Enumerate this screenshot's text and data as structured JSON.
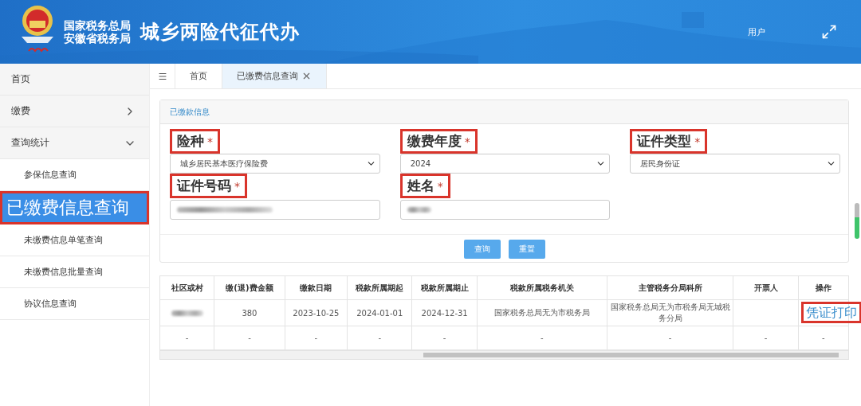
{
  "header": {
    "org_lines": [
      "国家税务总局",
      "安徽省税务局"
    ],
    "title": "城乡两险代征代办",
    "user": "用户"
  },
  "sidebar": {
    "items": [
      {
        "label": "首页",
        "selected": false,
        "highlighted": false
      },
      {
        "label": "缴费",
        "selected": false,
        "highlighted": false,
        "expanded": false
      },
      {
        "label": "查询统计",
        "selected": false,
        "highlighted": false,
        "expanded": true,
        "children": [
          {
            "label": "参保信息查询",
            "selected": false,
            "highlighted": false
          },
          {
            "label": "已缴费信息查询",
            "selected": true,
            "highlighted": true
          },
          {
            "label": "未缴费信息单笔查询",
            "selected": false,
            "highlighted": false
          },
          {
            "label": "未缴费信息批量查询",
            "selected": false,
            "highlighted": false
          },
          {
            "label": "协议信息查询",
            "selected": false,
            "highlighted": false
          }
        ]
      }
    ]
  },
  "tabs": [
    {
      "label": "首页",
      "selected": false,
      "closable": false
    },
    {
      "label": "已缴费信息查询",
      "selected": true,
      "closable": true
    }
  ],
  "panel": {
    "title": "已缴款信息",
    "fields": [
      {
        "label": "险种",
        "required_mark": "*",
        "highlighted": true,
        "kind": "select",
        "value": "城乡居民基本医疗保险费"
      },
      {
        "label": "缴费年度",
        "required_mark": "*",
        "highlighted": true,
        "kind": "select",
        "value": "2024"
      },
      {
        "label": "证件类型",
        "required_mark": "*",
        "highlighted": true,
        "kind": "select",
        "value": "居民身份证"
      },
      {
        "label": "证件号码",
        "required_mark": "*",
        "highlighted": true,
        "kind": "redacted"
      },
      {
        "label": "姓名",
        "required_mark": "*",
        "highlighted": true,
        "kind": "redacted"
      }
    ],
    "buttons": [
      "查询",
      "重置"
    ]
  },
  "table": {
    "columns": [
      "社区或村",
      "缴(退)费金额",
      "缴款日期",
      "税款所属期起",
      "税款所属期止",
      "税款所属税务机关",
      "主管税务分局科所",
      "开票人",
      "操作"
    ],
    "rows": [
      {
        "cells": [
          {
            "kind": "redacted"
          },
          {
            "kind": "text",
            "text": "380"
          },
          {
            "kind": "text",
            "text": "2023-10-25"
          },
          {
            "kind": "text",
            "text": "2024-01-01"
          },
          {
            "kind": "text",
            "text": "2024-12-31"
          },
          {
            "kind": "text",
            "text": "国家税务总局无为市税务局"
          },
          {
            "kind": "text",
            "text": "国家税务总局无为市税务局无城税务分局"
          },
          {
            "kind": "blank"
          },
          {
            "kind": "link",
            "text": "凭证打印",
            "highlighted": true
          }
        ]
      },
      {
        "cells": [
          {
            "kind": "text",
            "text": "-"
          },
          {
            "kind": "text",
            "text": "-"
          },
          {
            "kind": "text",
            "text": "-"
          },
          {
            "kind": "text",
            "text": "-"
          },
          {
            "kind": "text",
            "text": "-"
          },
          {
            "kind": "text",
            "text": "-"
          },
          {
            "kind": "text",
            "text": "-"
          },
          {
            "kind": "text",
            "text": "-"
          },
          {
            "kind": "text",
            "text": "-"
          }
        ]
      }
    ]
  }
}
